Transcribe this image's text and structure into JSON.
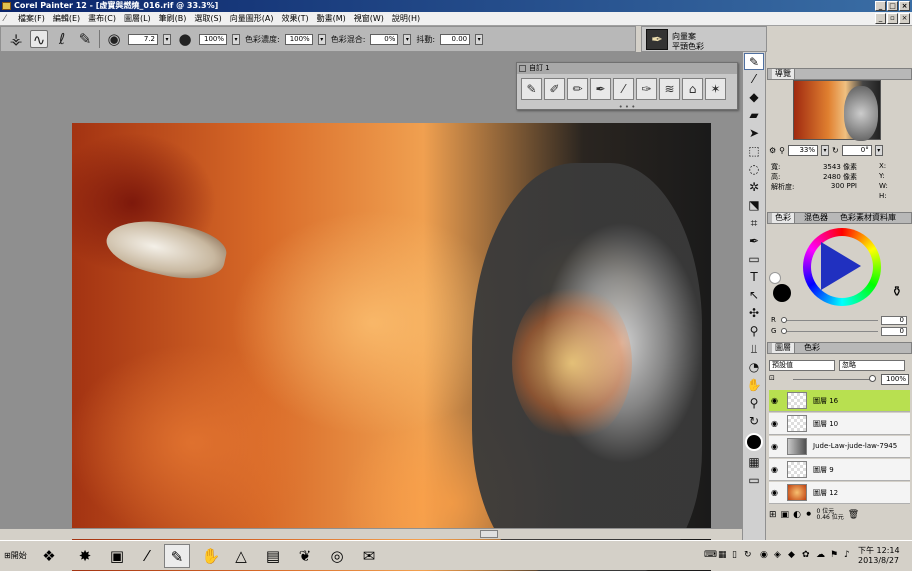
{
  "window": {
    "title": "Corel Painter 12 - [虚實與燃燒_016.rif @ 33.3%]"
  },
  "menu": [
    "檔案(F)",
    "編輯(E)",
    "畫布(C)",
    "圖層(L)",
    "筆刷(B)",
    "選取(S)",
    "向量圖形(A)",
    "效果(T)",
    "動畫(M)",
    "視窗(W)",
    "說明(H)"
  ],
  "property_bar": {
    "size_value": "7.2",
    "opacity_value": "100%",
    "resat_label": "色彩濃度:",
    "resat_value": "100%",
    "bleed_label": "色彩混合:",
    "bleed_value": "0%",
    "jitter_label": "抖動:",
    "jitter_value": "0.00"
  },
  "brush_selector": {
    "category": "向量案",
    "variant": "平頭色彩"
  },
  "dab_palette": {
    "title": "自訂 1"
  },
  "navigator": {
    "tab": "導覽",
    "zoom": "33%",
    "angle": "0°",
    "width_label": "寬:",
    "width_value": "3543 像素",
    "height_label": "高:",
    "height_value": "2480 像素",
    "res_label": "解析度:",
    "res_value": "300 PPI",
    "x_label": "X:",
    "y_label": "Y:",
    "w_label": "W:",
    "h_label": "H:"
  },
  "color_panel": {
    "tabs": [
      "色彩",
      "混色器",
      "色彩素材資料庫"
    ],
    "r_label": "R",
    "r_value": "0",
    "g_label": "G",
    "g_value": "0"
  },
  "layers_panel": {
    "tabs": [
      "圖層",
      "色彩"
    ],
    "composite_method": "預設值",
    "composite_depth": "忽略",
    "opacity": "100%",
    "layers": [
      {
        "name": "圖層 16",
        "selected": true,
        "thumb": "blank"
      },
      {
        "name": "圖層 10",
        "selected": false,
        "thumb": "blank"
      },
      {
        "name": "Jude-Law-jude-law-7945",
        "selected": false,
        "thumb": "img"
      },
      {
        "name": "圖層 9",
        "selected": false,
        "thumb": "blank"
      },
      {
        "name": "圖層 12",
        "selected": false,
        "thumb": "fire"
      }
    ],
    "status_a": "0 位元",
    "status_b": "0.46 位元"
  },
  "taskbar": {
    "start_label": "開始",
    "clock_time": "下午 12:14",
    "clock_date": "2013/8/27"
  }
}
